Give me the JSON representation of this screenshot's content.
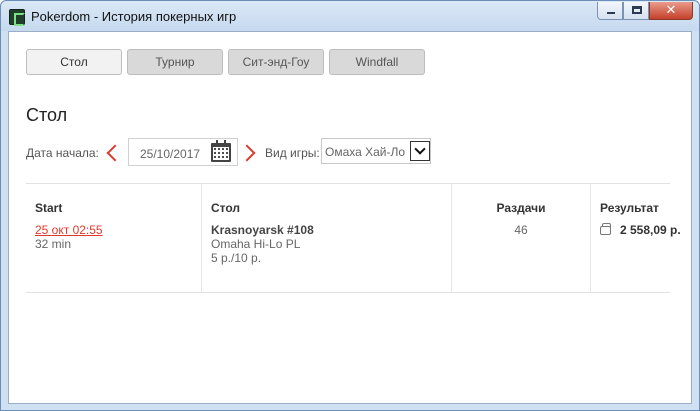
{
  "window": {
    "title": "Pokerdom - История покерных игр",
    "close_glyph": "✕"
  },
  "tabs": [
    {
      "label": "Стол",
      "active": true
    },
    {
      "label": "Турнир",
      "active": false
    },
    {
      "label": "Сит-энд-Гоу",
      "active": false
    },
    {
      "label": "Windfall",
      "active": false
    }
  ],
  "section_title": "Стол",
  "filters": {
    "start_date_label": "Дата начала:",
    "start_date_value": "25/10/2017",
    "game_type_label": "Вид игры:",
    "game_type_value": "Омаха Хай-Ло"
  },
  "table": {
    "columns": {
      "start": "Start",
      "table": "Стол",
      "hands": "Раздачи",
      "result": "Результат"
    },
    "rows": [
      {
        "start_time": "25 окт 02:55",
        "duration": "32 min",
        "table_name": "Krasnoyarsk #108",
        "game": "Omaha Hi-Lo PL",
        "stakes": "5 р./10 р.",
        "hands": "46",
        "result": "2 558,09 р."
      }
    ]
  },
  "icons": {
    "calendar": "calendar-icon",
    "prev": "chevron-left-icon",
    "next": "chevron-right-icon",
    "dropdown": "chevron-down-icon",
    "wallet": "wallet-icon"
  },
  "colors": {
    "accent": "#e03a2e"
  }
}
